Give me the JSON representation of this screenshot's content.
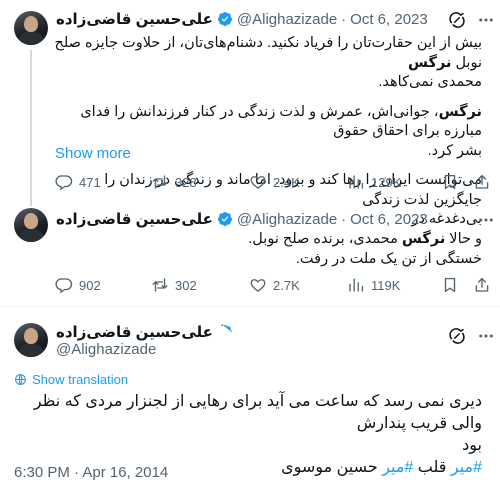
{
  "tweets": [
    {
      "author_name": "علی‌حسین قاضی‌زاده",
      "handle": "@Alighazizade",
      "date": "Oct 6, 2023",
      "lines": [
        [
          "بیش از این حقارت‌تان را فریاد نکنید. دشنام‌های‌تان، از حلاوت جایزه صلح نوبل ",
          "نرگس",
          ""
        ],
        [
          "محمدی نمی‌کاهد.",
          "",
          ""
        ],
        [
          "",
          "نرگس",
          "، جوانی‌اش، عمرش و لذت زندگی در کنار فرزندانش را فدای مبارزه برای احقاق حقوق"
        ],
        [
          "بشر کرد.",
          "",
          ""
        ],
        [
          "می‌توانست ایران را رها کند و برود. اما ماند و زندگی در زندان را جایگزین لذت زندگی",
          "",
          ""
        ],
        [
          "بی‌دغدغه در",
          "",
          ""
        ]
      ],
      "show_more": "Show more",
      "replies": "471",
      "reposts": "328",
      "likes": "2.4K",
      "views": "129K"
    },
    {
      "author_name": "علی‌حسین قاضی‌زاده",
      "handle": "@Alighazizade",
      "date": "Oct 6, 2023",
      "lines": [
        [
          "و حالا ",
          "نرگس",
          " محمدی، برنده صلح نوبل."
        ],
        [
          "خستگی از تن یک ملت در رفت.",
          "",
          ""
        ]
      ],
      "replies": "902",
      "reposts": "302",
      "likes": "2.7K",
      "views": "119K"
    },
    {
      "author_name": "علی‌حسین قاضی‌زاده",
      "handle": "@Alighazizade",
      "show_translation": "Show translation",
      "line1": "دیری نمی رسد که ساعت می آید برای رهایی از لجنزار مردی که نظر والی قریب پندارش",
      "line2": "بود",
      "hashtags": [
        "#میر",
        "#میر"
      ],
      "line3_parts": [
        "",
        "#میر",
        " قلب ",
        "#میر",
        " حسین موسوی"
      ],
      "timestamp": "6:30 PM · Apr 16, 2014"
    }
  ],
  "colors": {
    "accent": "#1d9bf0",
    "text": "#0f1419",
    "muted": "#536471",
    "divider": "#eff3f4"
  },
  "icons": [
    "grok-icon",
    "more-icon",
    "verified-icon",
    "reply-icon",
    "repost-icon",
    "like-icon",
    "views-icon",
    "bookmark-icon",
    "share-icon",
    "translate-icon"
  ]
}
